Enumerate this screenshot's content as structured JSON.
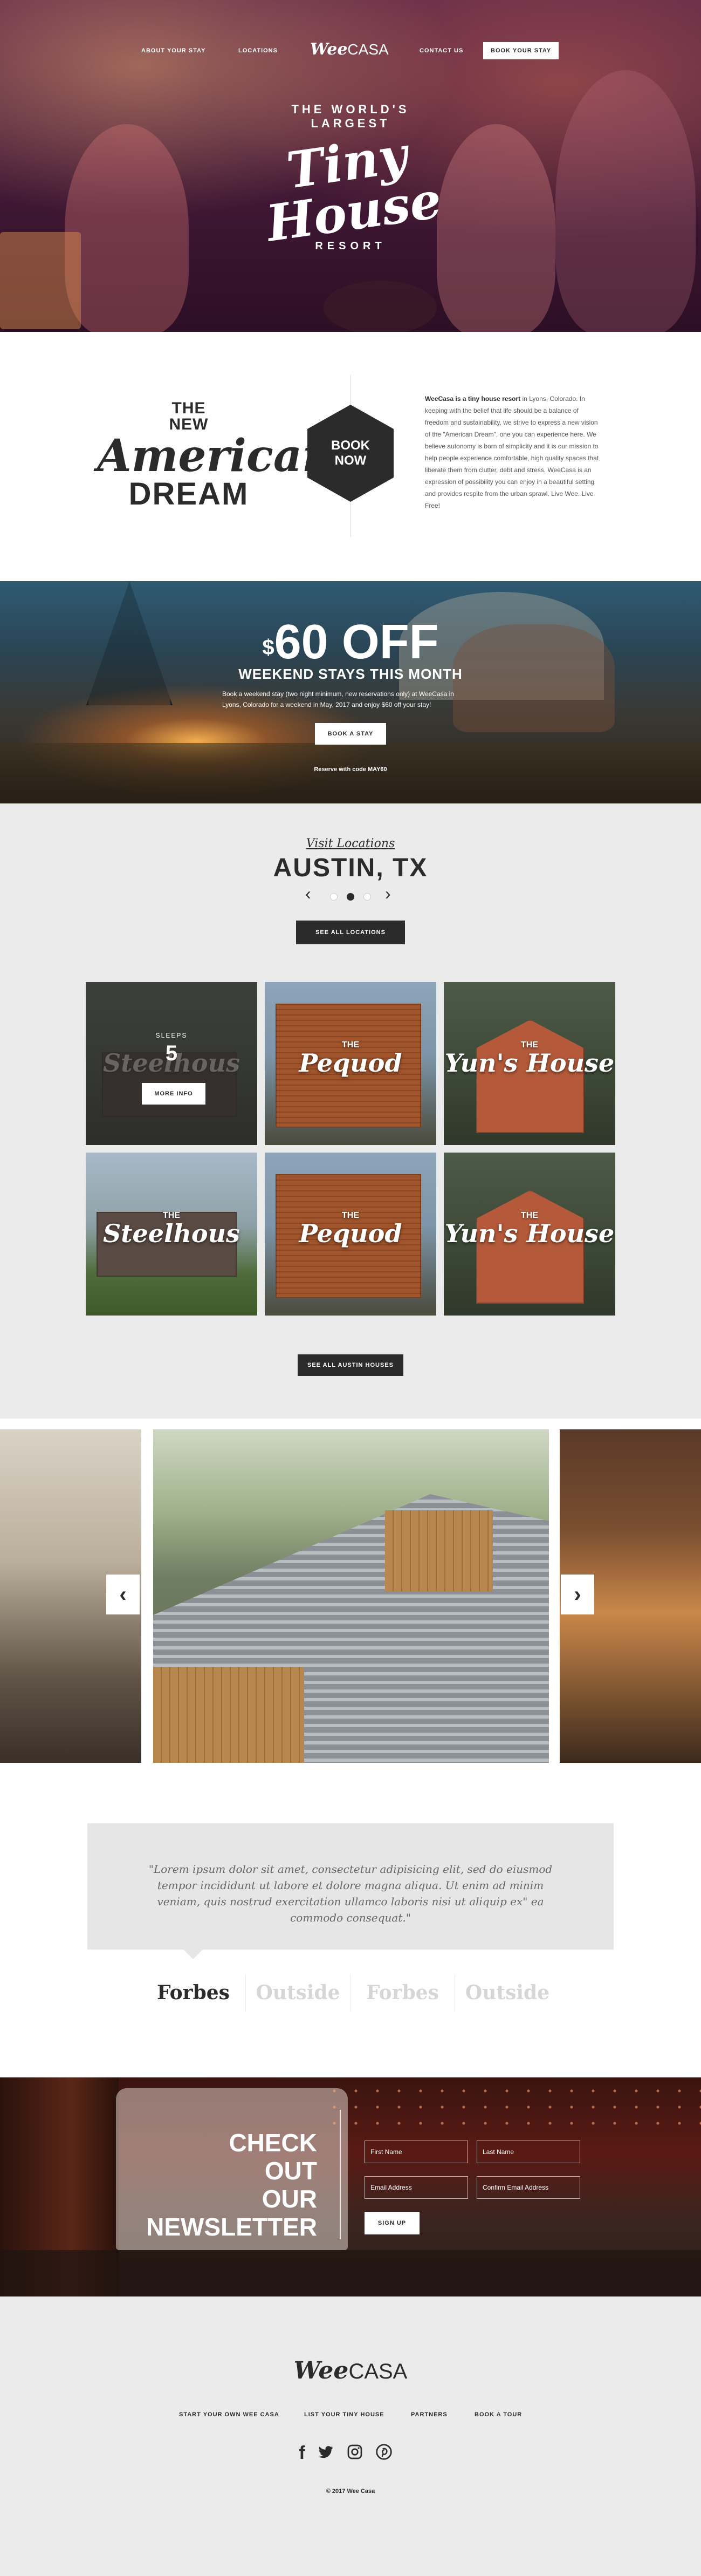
{
  "nav": {
    "about": "ABOUT YOUR STAY",
    "locations": "LOCATIONS",
    "logo_wee": "Wee",
    "logo_casa": "CASA",
    "contact": "CONTACT US",
    "book": "BOOK YOUR STAY"
  },
  "hero": {
    "arc": "THE WORLD'S LARGEST",
    "tiny": "Tiny",
    "house": "House",
    "resort": "RESORT"
  },
  "dream": {
    "the": "THE",
    "new": "NEW",
    "american": "American",
    "dream": "DREAM",
    "book_line1": "BOOK",
    "book_line2": "NOW",
    "text_bold": "WeeCasa is a tiny house resort",
    "text": " in Lyons, Colorado. In keeping with the belief that life should be a balance of freedom and sustainability, we strive to express a new vision of the \"American Dream\", one you can experience here. We believe autonomy is born of simplicity and it is our mission to help people experience comfortable, high quality spaces that liberate them from clutter, debt and stress. WeeCasa is an expression of possibility you can enjoy in a beautiful setting and provides respite from the urban sprawl. Live Wee. Live Free!"
  },
  "promo": {
    "currency": "$",
    "amount": "60 OFF",
    "sub": "WEEKEND STAYS THIS MONTH",
    "desc": "Book a weekend stay (two night minimum, new reservations only) at WeeCasa in Lyons, Colorado for a weekend in May, 2017 and enjoy $60 off your stay!",
    "button": "BOOK A STAY",
    "code": "Reserve with code MAY60"
  },
  "locations": {
    "visit": "Visit Locations",
    "city": "AUSTIN, TX",
    "see_all": "SEE ALL LOCATIONS",
    "see_all_houses": "SEE ALL AUSTIN HOUSES",
    "houses": [
      {
        "the": "THE",
        "name": "Steelhous",
        "sleeps": "SLEEPS",
        "sleeps_num": "5",
        "more": "MORE INFO"
      },
      {
        "the": "THE",
        "name": "Pequod"
      },
      {
        "the": "THE",
        "name": "Yun's House"
      },
      {
        "the": "THE",
        "name": "Steelhous"
      },
      {
        "the": "THE",
        "name": "Pequod"
      },
      {
        "the": "THE",
        "name": "Yun's House"
      }
    ]
  },
  "press": {
    "quote": "\"Lorem ipsum dolor sit amet, consectetur adipisicing elit, sed do eiusmod tempor incididunt ut labore et dolore magna aliqua. Ut enim ad minim veniam, quis nostrud exercitation ullamco laboris nisi ut aliquip ex\" ea commodo consequat.\"",
    "logos": [
      "Forbes",
      "Outside",
      "Forbes",
      "Outside"
    ]
  },
  "newsletter": {
    "line1": "CHECK",
    "line2": "OUT",
    "line3": "OUR",
    "line4": "NEWSLETTER",
    "first_name": "First Name",
    "last_name": "Last Name",
    "email": "Email Address",
    "confirm_email": "Confirm Email Address",
    "signup": "SIGN UP"
  },
  "footer": {
    "logo_wee": "Wee",
    "logo_casa": "CASA",
    "links": [
      "START YOUR OWN WEE CASA",
      "LIST YOUR TINY HOUSE",
      "PARTNERS",
      "BOOK A TOUR"
    ],
    "social": [
      "facebook-icon",
      "twitter-icon",
      "instagram-icon",
      "pinterest-icon"
    ],
    "copyright": "© 2017 Wee Casa"
  }
}
